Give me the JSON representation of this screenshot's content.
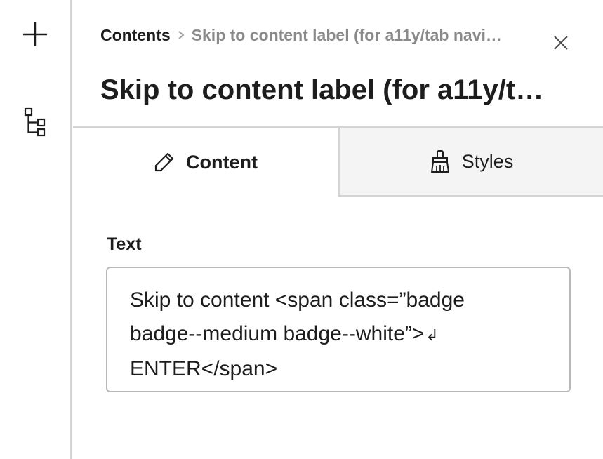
{
  "rail": {
    "items": [
      {
        "icon": "plus-icon"
      },
      {
        "icon": "tree-structure-icon"
      }
    ]
  },
  "breadcrumb": {
    "root": "Contents",
    "current": "Skip to content label (for a11y/tab navi…"
  },
  "panel": {
    "title": "Skip to content label (for a11y/t…"
  },
  "tabs": [
    {
      "label": "Content",
      "icon": "pencil-icon",
      "active": true
    },
    {
      "label": "Styles",
      "icon": "paintbrush-icon",
      "active": false
    }
  ],
  "field": {
    "label": "Text",
    "lines": [
      "Skip to content <span class=”badge",
      "badge--medium badge--white”>",
      "ENTER</span>"
    ],
    "line_break_marker": "↲"
  }
}
